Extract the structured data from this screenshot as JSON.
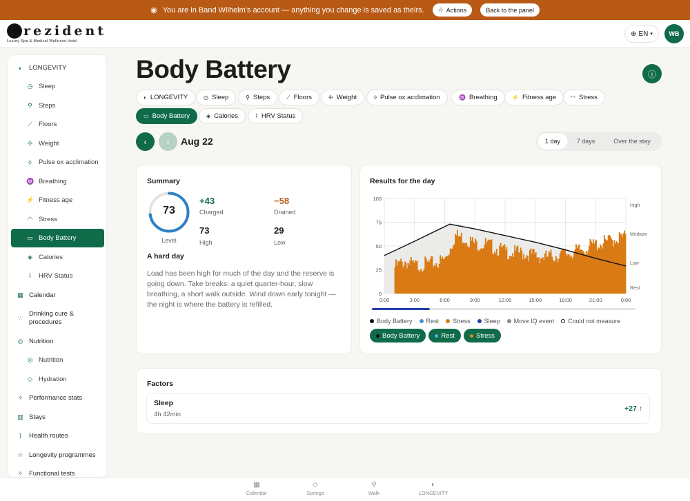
{
  "banner": {
    "message": "You are in Band Wilhelm's account — anything you change is saved as theirs.",
    "actions_label": "Actions",
    "back_label": "Back to the panel"
  },
  "header": {
    "brand_name": "rezident",
    "brand_tagline": "Luxury Spa & Medical Wellness Hotel",
    "language": "EN",
    "avatar_initials": "WB"
  },
  "sidebar": {
    "items": [
      {
        "label": "LONGEVITY",
        "icon": "leaf-icon",
        "level": "top"
      },
      {
        "label": "Sleep",
        "icon": "clock-icon",
        "level": "sub"
      },
      {
        "label": "Steps",
        "icon": "walk-icon",
        "level": "sub"
      },
      {
        "label": "Floors",
        "icon": "stairs-icon",
        "level": "sub"
      },
      {
        "label": "Weight",
        "icon": "scale-icon",
        "level": "sub"
      },
      {
        "label": "Pulse ox acclimation",
        "icon": "drop-icon",
        "level": "sub"
      },
      {
        "label": "Breathing",
        "icon": "lungs-icon",
        "level": "sub"
      },
      {
        "label": "Fitness age",
        "icon": "run-icon",
        "level": "sub"
      },
      {
        "label": "Stress",
        "icon": "gauge-icon",
        "level": "sub"
      },
      {
        "label": "Body Battery",
        "icon": "battery-icon",
        "level": "sub",
        "active": true
      },
      {
        "label": "Calories",
        "icon": "flame-icon",
        "level": "sub"
      },
      {
        "label": "HRV Status",
        "icon": "pulse-icon",
        "level": "sub"
      },
      {
        "label": "Calendar",
        "icon": "calendar-icon",
        "level": "top"
      },
      {
        "label": "Drinking cure & procedures",
        "icon": "heart-icon",
        "level": "top"
      },
      {
        "label": "Nutrition",
        "icon": "target-icon",
        "level": "top"
      },
      {
        "label": "Nutrition",
        "icon": "target-icon",
        "level": "sub"
      },
      {
        "label": "Hydration",
        "icon": "water-icon",
        "level": "sub"
      },
      {
        "label": "Performance stats",
        "icon": "sparkle-icon",
        "level": "top"
      },
      {
        "label": "Stays",
        "icon": "building-icon",
        "level": "top"
      },
      {
        "label": "Health routes",
        "icon": "route-icon",
        "level": "top"
      },
      {
        "label": "Longevity programmes",
        "icon": "star-icon",
        "level": "top"
      },
      {
        "label": "Functional tests",
        "icon": "sparkle-icon",
        "level": "top"
      }
    ]
  },
  "page": {
    "title": "Body Battery",
    "date": "Aug 22"
  },
  "chips": [
    {
      "label": "LONGEVITY",
      "icon": "leaf-icon"
    },
    {
      "label": "Sleep",
      "icon": "clock-icon"
    },
    {
      "label": "Steps",
      "icon": "walk-icon"
    },
    {
      "label": "Floors",
      "icon": "stairs-icon"
    },
    {
      "label": "Weight",
      "icon": "scale-icon"
    },
    {
      "label": "Pulse ox acclimation",
      "icon": "drop-icon"
    },
    {
      "label": "Breathing",
      "icon": "lungs-icon"
    },
    {
      "label": "Fitness age",
      "icon": "run-icon"
    },
    {
      "label": "Stress",
      "icon": "gauge-icon"
    },
    {
      "label": "Body Battery",
      "icon": "battery-icon",
      "active": true
    },
    {
      "label": "Calories",
      "icon": "flame-icon"
    },
    {
      "label": "HRV Status",
      "icon": "pulse-icon"
    }
  ],
  "range": {
    "options": [
      "1 day",
      "7 days",
      "Over the stay"
    ],
    "selected": "1 day"
  },
  "summary": {
    "title": "Summary",
    "level": 73,
    "level_label": "Level",
    "charged_value": "+43",
    "charged_label": "Charged",
    "drained_value": "−58",
    "drained_label": "Drained",
    "high_value": "73",
    "high_label": "High",
    "low_value": "29",
    "low_label": "Low",
    "headline": "A hard day",
    "description": "Load has been high for much of the day and the reserve is going down. Take breaks: a quiet quarter-hour, slow breathing, a short walk outside. Wind down early tonight — the night is where the battery is refilled."
  },
  "results": {
    "title": "Results for the day",
    "legend": [
      {
        "label": "Body Battery",
        "color": "#111111"
      },
      {
        "label": "Rest",
        "color": "#4a90d9"
      },
      {
        "label": "Stress",
        "color": "#d97a14"
      },
      {
        "label": "Sleep",
        "color": "#2440a8"
      },
      {
        "label": "Move IQ event",
        "color": "#8a8a86"
      },
      {
        "label": "Could not measure",
        "color": "#ffffff"
      }
    ],
    "toggles": [
      {
        "label": "Body Battery",
        "color": "#111111"
      },
      {
        "label": "Rest",
        "color": "#4ab0e0"
      },
      {
        "label": "Stress",
        "color": "#e08a20"
      }
    ]
  },
  "chart_data": {
    "type": "line",
    "x_ticks": [
      "0:00",
      "3:00",
      "6:00",
      "9:00",
      "12:00",
      "15:00",
      "18:00",
      "21:00",
      "0:00"
    ],
    "y_ticks": [
      0,
      25,
      50,
      75,
      100
    ],
    "ylim": [
      0,
      100
    ],
    "xlim_hours": [
      0,
      24
    ],
    "right_labels": [
      "High",
      "Medium",
      "Low",
      "Rest"
    ],
    "grid": true,
    "series": [
      {
        "name": "Body Battery",
        "type": "line",
        "color": "#111111",
        "x_hours": [
          0,
          3,
          6.5,
          9,
          12,
          15,
          18,
          21,
          24
        ],
        "values": [
          40,
          55,
          73,
          68,
          61,
          54,
          46,
          37,
          29
        ]
      },
      {
        "name": "Stress",
        "type": "bar",
        "color": "#d97a14",
        "x_hours": [
          1,
          2,
          3,
          4,
          5,
          6,
          7,
          8,
          9,
          10,
          11,
          12,
          13,
          14,
          15,
          16,
          17,
          18,
          19,
          20,
          21,
          22,
          23,
          24
        ],
        "values": [
          32,
          38,
          33,
          35,
          36,
          40,
          65,
          62,
          56,
          56,
          52,
          48,
          47,
          46,
          44,
          42,
          44,
          46,
          48,
          52,
          56,
          58,
          62,
          64
        ]
      }
    ],
    "sleep_bar_hours": [
      0,
      5
    ]
  },
  "factors": {
    "title": "Factors",
    "items": [
      {
        "name": "Sleep",
        "detail": "4h 42min",
        "value": "+27 ↑"
      }
    ]
  },
  "bottom_nav": [
    {
      "label": "Calendar",
      "icon": "calendar-icon"
    },
    {
      "label": "Springs",
      "icon": "water-icon"
    },
    {
      "label": "Walk",
      "icon": "walk-icon"
    },
    {
      "label": "LONGEVITY",
      "icon": "leaf-icon"
    }
  ]
}
